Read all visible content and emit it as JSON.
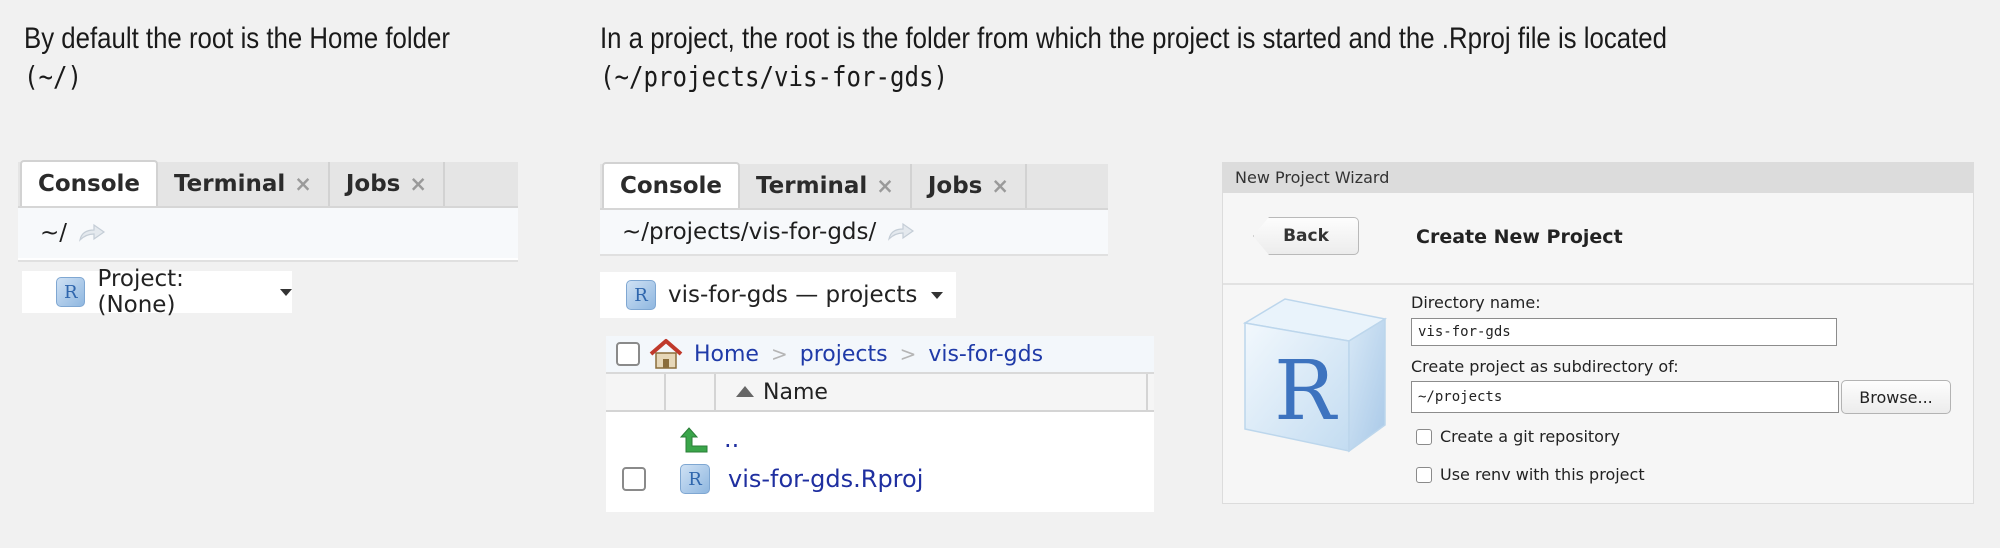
{
  "captions": {
    "default": {
      "line1": "By default the root is the Home folder",
      "path": "(~/)"
    },
    "project": {
      "line1": "In a project, the root is the folder from which the project is started and the .Rproj file is located",
      "path": "(~/projects/vis-for-gds)"
    }
  },
  "console_default": {
    "tabs": [
      {
        "label": "Console"
      },
      {
        "label": "Terminal",
        "close": "×"
      },
      {
        "label": "Jobs",
        "close": "×"
      }
    ],
    "path": "~/",
    "project_button": "Project: (None)"
  },
  "console_project": {
    "tabs": [
      {
        "label": "Console"
      },
      {
        "label": "Terminal",
        "close": "×"
      },
      {
        "label": "Jobs",
        "close": "×"
      }
    ],
    "path": "~/projects/vis-for-gds/",
    "project_button": "vis-for-gds — projects"
  },
  "r_logo_letter": "R",
  "files": {
    "breadcrumb": [
      "Home",
      "projects",
      "vis-for-gds"
    ],
    "breadcrumb_sep": ">",
    "column_name": "Name",
    "up_label": "..",
    "items": [
      {
        "name": "vis-for-gds.Rproj"
      }
    ]
  },
  "wizard": {
    "window_title": "New Project Wizard",
    "back_label": "Back",
    "heading": "Create New Project",
    "dir_name_label": "Directory name:",
    "dir_name_value": "vis-for-gds",
    "subdir_label": "Create project as subdirectory of:",
    "subdir_value": "~/projects",
    "browse_label": "Browse...",
    "git_label": "Create a git repository",
    "renv_label": "Use renv with this project",
    "logo_letter": "R"
  },
  "colors": {
    "link": "#1f2fa0",
    "background": "#f1f1f1",
    "home_icon": "#c0392b",
    "up_arrow": "#3aa54a"
  }
}
